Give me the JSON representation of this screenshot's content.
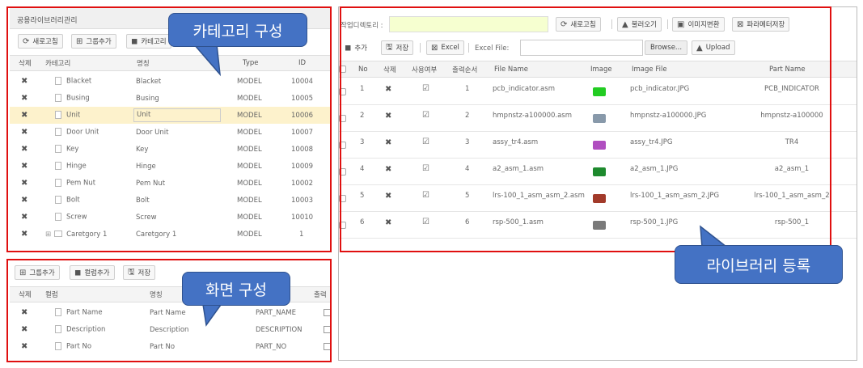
{
  "category_panel": {
    "title": "공용라이브러리관리",
    "buttons": {
      "refresh": "새로고침",
      "add_group": "그룹추가",
      "add_category": "카테고리"
    },
    "columns": {
      "delete": "삭제",
      "category": "카테고리",
      "name": "명칭",
      "type": "Type",
      "id": "ID"
    },
    "rows": [
      {
        "category": "Blacket",
        "name": "Blacket",
        "type": "MODEL",
        "id": "10004"
      },
      {
        "category": "Busing",
        "name": "Busing",
        "type": "MODEL",
        "id": "10005"
      },
      {
        "category": "Unit",
        "name": "Unit",
        "type": "MODEL",
        "id": "10006"
      },
      {
        "category": "Door Unit",
        "name": "Door Unit",
        "type": "MODEL",
        "id": "10007"
      },
      {
        "category": "Key",
        "name": "Key",
        "type": "MODEL",
        "id": "10008"
      },
      {
        "category": "Hinge",
        "name": "Hinge",
        "type": "MODEL",
        "id": "10009"
      },
      {
        "category": "Pem Nut",
        "name": "Pem Nut",
        "type": "MODEL",
        "id": "10002"
      },
      {
        "category": "Bolt",
        "name": "Bolt",
        "type": "MODEL",
        "id": "10003"
      },
      {
        "category": "Screw",
        "name": "Screw",
        "type": "MODEL",
        "id": "10010"
      },
      {
        "category": "Caretgory 1",
        "name": "Caretgory 1",
        "type": "MODEL",
        "id": "1"
      }
    ]
  },
  "screen_panel": {
    "buttons": {
      "add_group": "그룹추가",
      "add_column": "컬럼추가",
      "save": "저장"
    },
    "columns": {
      "delete": "삭제",
      "column": "컬럼",
      "name": "명칭",
      "output": "출력"
    },
    "rows": [
      {
        "column": "Part Name",
        "name": "Part Name",
        "code": "PART_NAME"
      },
      {
        "column": "Description",
        "name": "Description",
        "code": "DESCRIPTION"
      },
      {
        "column": "Part No",
        "name": "Part No",
        "code": "PART_NO"
      }
    ]
  },
  "library_panel": {
    "upload_dir_label": "작업디렉토리 :",
    "buttons": {
      "refresh": "새로고침",
      "load": "불러오기",
      "image_convert": "이미지변환",
      "param_save": "파라메터저장",
      "add": "추가",
      "save": "저장",
      "excel": "Excel",
      "browse": "Browse...",
      "upload": "Upload"
    },
    "excel_file_label": "Excel File:",
    "columns": {
      "no": "No",
      "delete": "삭제",
      "use": "사용여부",
      "order": "출력순서",
      "file_name": "File Name",
      "image": "Image",
      "image_file": "Image File",
      "part_name": "Part Name"
    },
    "rows": [
      {
        "no": "1",
        "order": "1",
        "file_name": "pcb_indicator.asm",
        "image_file": "pcb_indicator.JPG",
        "part_name": "PCB_INDICATOR",
        "thumb_color": "#22cc22"
      },
      {
        "no": "2",
        "order": "2",
        "file_name": "hmpnstz-a100000.asm",
        "image_file": "hmpnstz-a100000.JPG",
        "part_name": "hmpnstz-a100000",
        "thumb_color": "#8899aa"
      },
      {
        "no": "3",
        "order": "3",
        "file_name": "assy_tr4.asm",
        "image_file": "assy_tr4.JPG",
        "part_name": "TR4",
        "thumb_color": "#b04fc0"
      },
      {
        "no": "4",
        "order": "4",
        "file_name": "a2_asm_1.asm",
        "image_file": "a2_asm_1.JPG",
        "part_name": "a2_asm_1",
        "thumb_color": "#1e8a2e"
      },
      {
        "no": "5",
        "order": "5",
        "file_name": "lrs-100_1_asm_asm_2.asm",
        "image_file": "lrs-100_1_asm_asm_2.JPG",
        "part_name": "lrs-100_1_asm_asm_2",
        "thumb_color": "#a23a2a"
      },
      {
        "no": "6",
        "order": "6",
        "file_name": "rsp-500_1.asm",
        "image_file": "rsp-500_1.JPG",
        "part_name": "rsp-500_1",
        "thumb_color": "#7a7a7a"
      }
    ]
  },
  "callouts": {
    "category": "카테고리 구성",
    "screen": "화면 구성",
    "library": "라이브러리 등록"
  },
  "colors": {
    "selected_row": "#fdf2cc",
    "upload_field": "#f6ffd0",
    "callout_fill": "#4472c4",
    "highlight_border": "#e01010"
  }
}
